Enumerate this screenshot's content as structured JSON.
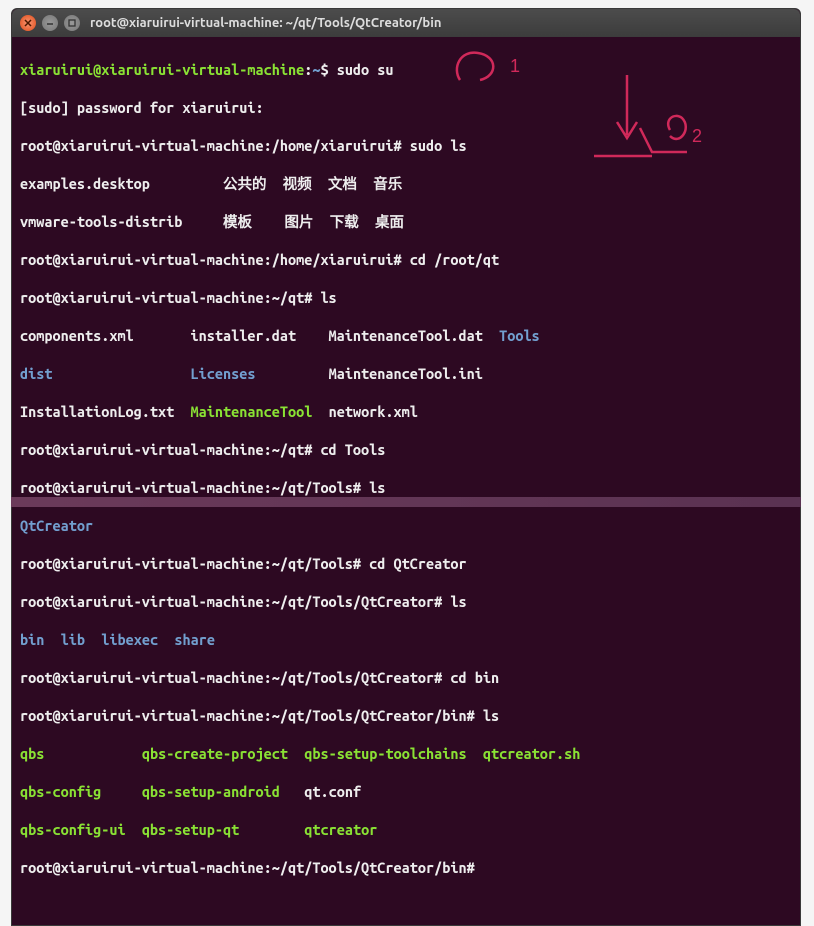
{
  "titlebar": {
    "title": "root@xiaruirui-virtual-machine: ~/qt/Tools/QtCreator/bin"
  },
  "lines": {
    "l1a": "xiaruirui@xiaruirui-virtual-machine",
    "l1b": ":",
    "l1c": "~",
    "l1d": "$ sudo su",
    "l2": "[sudo] password for xiaruirui:",
    "l3": "root@xiaruirui-virtual-machine:/home/xiaruirui# sudo ls",
    "l4a": "examples.desktop         公共的  视频  文档  音乐",
    "l5a": "vmware-tools-distrib     模板    图片  下载  桌面",
    "l6": "root@xiaruirui-virtual-machine:/home/xiaruirui# cd /root/qt",
    "l7": "root@xiaruirui-virtual-machine:~/qt# ls",
    "l8a": "components.xml       installer.dat    MaintenanceTool.dat  ",
    "l8b": "Tools",
    "l9a": "dist",
    "l9b": "                 ",
    "l9c": "Licenses",
    "l9d": "         MaintenanceTool.ini",
    "l10a": "InstallationLog.txt  ",
    "l10b": "MaintenanceTool",
    "l10c": "  network.xml",
    "l11": "root@xiaruirui-virtual-machine:~/qt# cd Tools",
    "l12": "root@xiaruirui-virtual-machine:~/qt/Tools# ls",
    "l13": "QtCreator",
    "l14": "root@xiaruirui-virtual-machine:~/qt/Tools# cd QtCreator",
    "l15": "root@xiaruirui-virtual-machine:~/qt/Tools/QtCreator# ls",
    "l16a": "bin",
    "l16s1": "  ",
    "l16b": "lib",
    "l16s2": "  ",
    "l16c": "libexec",
    "l16s3": "  ",
    "l16d": "share",
    "l17": "root@xiaruirui-virtual-machine:~/qt/Tools/QtCreator# cd bin",
    "l18": "root@xiaruirui-virtual-machine:~/qt/Tools/QtCreator/bin# ls",
    "l19a": "qbs",
    "l19s": "            ",
    "l19b": "qbs-create-project",
    "l19s2": "  ",
    "l19c": "qbs-setup-toolchains",
    "l19s3": "  ",
    "l19d": "qtcreator.sh",
    "l20a": "qbs-config",
    "l20s": "     ",
    "l20b": "qbs-setup-android",
    "l20s2": "   qt.conf",
    "l21a": "qbs-config-ui",
    "l21s": "  ",
    "l21b": "qbs-setup-qt",
    "l21s2": "        ",
    "l21c": "qtcreator",
    "l22": "root@xiaruirui-virtual-machine:~/qt/Tools/QtCreator/bin# "
  },
  "annotations": {
    "label1": "1",
    "label2": "2"
  }
}
